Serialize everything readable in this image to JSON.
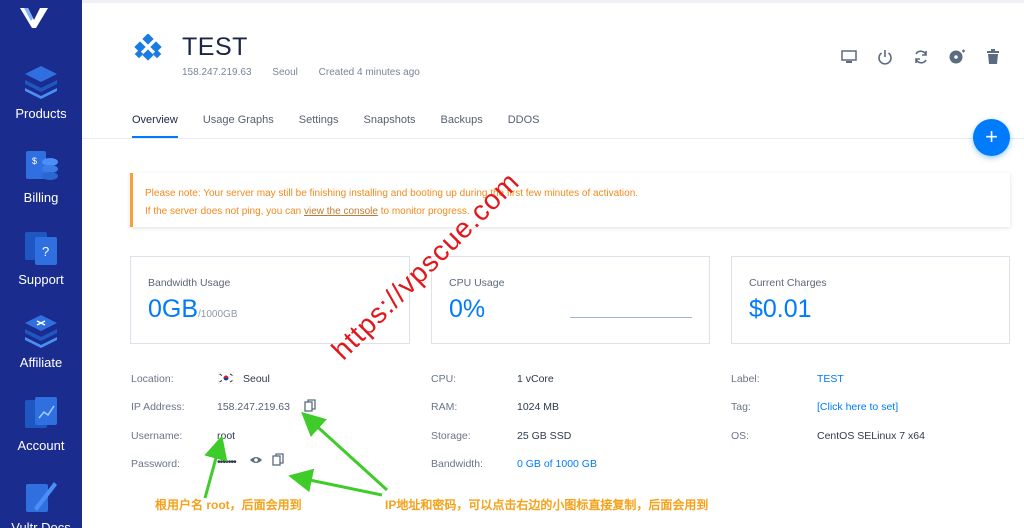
{
  "sidebar": {
    "items": [
      {
        "label": "Products",
        "icon": "stack-icon"
      },
      {
        "label": "Billing",
        "icon": "billing-icon"
      },
      {
        "label": "Support",
        "icon": "support-icon"
      },
      {
        "label": "Affiliate",
        "icon": "affiliate-icon"
      },
      {
        "label": "Account",
        "icon": "account-icon"
      },
      {
        "label": "Vultr Docs",
        "icon": "docs-icon"
      }
    ]
  },
  "server": {
    "name": "TEST",
    "ip": "158.247.219.63",
    "location": "Seoul",
    "created": "Created 4 minutes ago"
  },
  "tabs": [
    "Overview",
    "Usage Graphs",
    "Settings",
    "Snapshots",
    "Backups",
    "DDOS"
  ],
  "fab_label": "+",
  "notice": {
    "line1": "Please note: Your server may still be finishing installing and booting up during the first few minutes of activation.",
    "line2_pre": "If the server does not ping, you can ",
    "line2_link": "view the console",
    "line2_post": " to monitor progress."
  },
  "cards": {
    "bandwidth": {
      "label": "Bandwidth Usage",
      "value": "0GB",
      "suffix": "/1000GB"
    },
    "cpu": {
      "label": "CPU Usage",
      "value": "0%"
    },
    "charges": {
      "label": "Current Charges",
      "value": "$0.01"
    }
  },
  "details": {
    "location_label": "Location:",
    "location_value": "Seoul",
    "ip_label": "IP Address:",
    "ip_value": "158.247.219.63",
    "username_label": "Username:",
    "username_value": "root",
    "password_label": "Password:",
    "password_value": "•••••••",
    "cpu_label": "CPU:",
    "cpu_value": "1 vCore",
    "ram_label": "RAM:",
    "ram_value": "1024 MB",
    "storage_label": "Storage:",
    "storage_value": "25 GB SSD",
    "bandwidth_label": "Bandwidth:",
    "bandwidth_value": "0 GB of 1000 GB",
    "label_label": "Label:",
    "label_value": "TEST",
    "tag_label": "Tag:",
    "tag_value": "[Click here to set]",
    "os_label": "OS:",
    "os_value": "CentOS SELinux 7 x64"
  },
  "watermark": "https://vpscue.com",
  "annotations": {
    "left": "根用户名 root，后面会用到",
    "right": "IP地址和密码，可以点击右边的小图标直接复制，后面会用到"
  },
  "colors": {
    "sidebar": "#1b2c8f",
    "accent": "#007bfc",
    "warning": "#f7a035",
    "watermark": "#e3161b"
  }
}
